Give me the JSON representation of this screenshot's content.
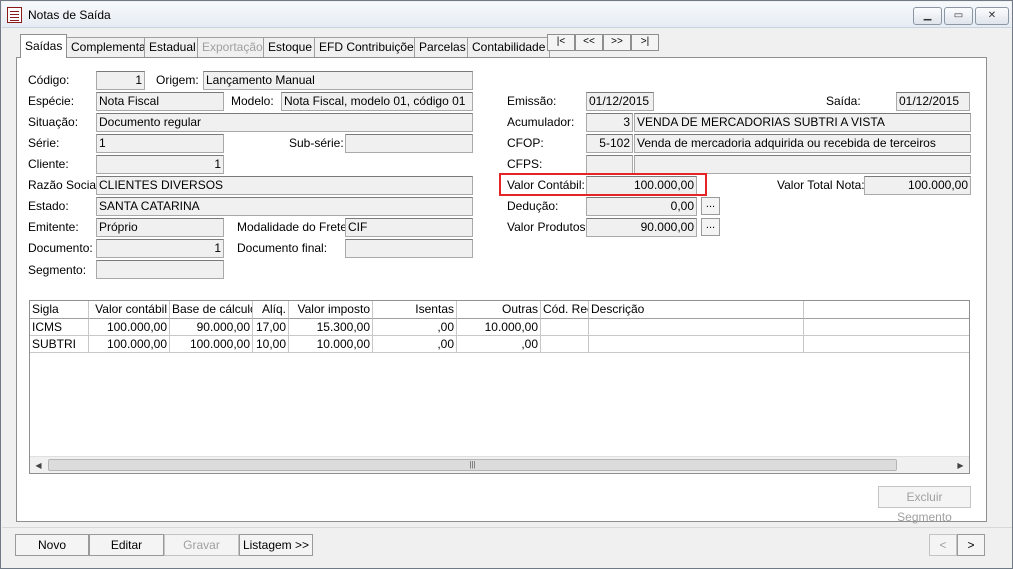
{
  "window": {
    "title": "Notas de Saída"
  },
  "tabs": [
    "Saídas",
    "Complementar",
    "Estadual",
    "Exportação",
    "Estoque",
    "EFD Contribuições",
    "Parcelas",
    "Contabilidade"
  ],
  "nav": {
    "first": "|<",
    "prev": "<<",
    "next": ">>",
    "last": ">|"
  },
  "form": {
    "codigo_label": "Código:",
    "codigo": "1",
    "origem_label": "Origem:",
    "origem": "Lançamento Manual",
    "especie_label": "Espécie:",
    "especie": "Nota Fiscal",
    "modelo_label": "Modelo:",
    "modelo": "Nota Fiscal, modelo 01, código 01",
    "situacao_label": "Situação:",
    "situacao": "Documento regular",
    "serie_label": "Série:",
    "serie": "1",
    "subserie_label": "Sub-série:",
    "subserie": "",
    "cliente_label": "Cliente:",
    "cliente": "1",
    "razao_label": "Razão Social:",
    "razao": "CLIENTES DIVERSOS",
    "estado_label": "Estado:",
    "estado": "SANTA CATARINA",
    "emitente_label": "Emitente:",
    "emitente": "Próprio",
    "frete_label": "Modalidade do Frete:",
    "frete": "CIF",
    "documento_label": "Documento:",
    "documento": "1",
    "docfinal_label": "Documento final:",
    "docfinal": "",
    "segmento_label": "Segmento:",
    "segmento": "",
    "emissao_label": "Emissão:",
    "emissao": "01/12/2015",
    "saida_label": "Saída:",
    "saida": "01/12/2015",
    "acumulador_label": "Acumulador:",
    "acumulador_cod": "3",
    "acumulador_desc": "VENDA DE MERCADORIAS SUBTRI  A VISTA",
    "cfop_label": "CFOP:",
    "cfop_cod": "5-102",
    "cfop_desc": "Venda de mercadoria adquirida ou recebida de terceiros",
    "cfps_label": "CFPS:",
    "cfps_cod": "",
    "cfps_desc": "",
    "valor_contabil_label": "Valor Contábil:",
    "valor_contabil": "100.000,00",
    "valor_total_label": "Valor Total Nota:",
    "valor_total": "100.000,00",
    "deducao_label": "Dedução:",
    "deducao": "0,00",
    "valor_produtos_label": "Valor Produtos:",
    "valor_produtos": "90.000,00",
    "dots": "..."
  },
  "grid": {
    "columns": [
      "Sigla",
      "Valor contábil",
      "Base de cálculo",
      "Alíq.",
      "Valor imposto",
      "Isentas",
      "Outras",
      "Cód. Rec.",
      "Descrição"
    ],
    "rows": [
      [
        "ICMS",
        "100.000,00",
        "90.000,00",
        "17,00",
        "15.300,00",
        ",00",
        "10.000,00",
        "",
        ""
      ],
      [
        "SUBTRI",
        "100.000,00",
        "100.000,00",
        "10,00",
        "10.000,00",
        ",00",
        ",00",
        "",
        ""
      ]
    ]
  },
  "buttons": {
    "excluir_segmento": "Excluir Segmento",
    "novo": "Novo",
    "editar": "Editar",
    "gravar": "Gravar",
    "listagem": "Listagem >>",
    "prev": "<",
    "next": ">"
  }
}
